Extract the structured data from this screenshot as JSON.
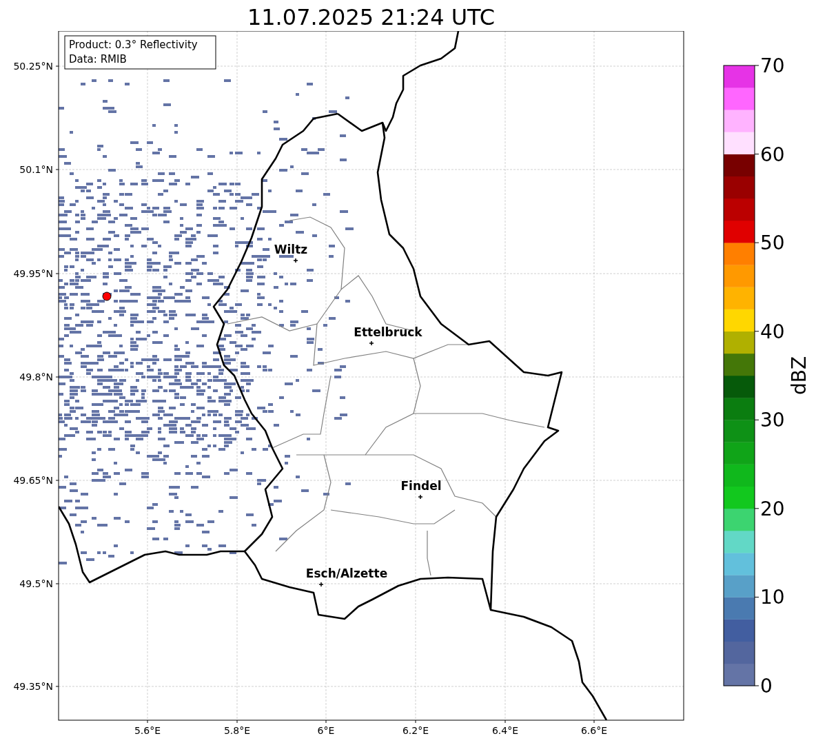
{
  "title": "11.07.2025 21:24 UTC",
  "info_box": {
    "lines": [
      "Product: 0.3° Reflectivity",
      "Data: RMIB"
    ]
  },
  "map": {
    "y_ticks": [
      "50.25°N",
      "50.1°N",
      "49.95°N",
      "49.8°N",
      "49.65°N",
      "49.5°N",
      "49.35°N"
    ],
    "x_ticks": [
      "5.6°E",
      "5.8°E",
      "6°E",
      "6.2°E",
      "6.4°E",
      "6.6°E"
    ],
    "cities": [
      {
        "name": "Wiltz"
      },
      {
        "name": "Ettelbruck"
      },
      {
        "name": "Findel"
      },
      {
        "name": "Esch/Alzette"
      }
    ]
  },
  "colorbar": {
    "label": "dBZ",
    "ticks": [
      "70",
      "60",
      "50",
      "40",
      "30",
      "20",
      "10",
      "0"
    ],
    "bands": [
      {
        "color": "#6474a6"
      },
      {
        "color": "#53669e"
      },
      {
        "color": "#425ea0"
      },
      {
        "color": "#4a7ab0"
      },
      {
        "color": "#58a0c8"
      },
      {
        "color": "#62c0dc"
      },
      {
        "color": "#62d8c6"
      },
      {
        "color": "#3cd470"
      },
      {
        "color": "#12c81e"
      },
      {
        "color": "#10b81c"
      },
      {
        "color": "#10a418"
      },
      {
        "color": "#0e9116"
      },
      {
        "color": "#0b7d10"
      },
      {
        "color": "#065a0a"
      },
      {
        "color": "#447708"
      },
      {
        "color": "#b0b000"
      },
      {
        "color": "#ffd700"
      },
      {
        "color": "#ffb300"
      },
      {
        "color": "#ff9900"
      },
      {
        "color": "#ff7f00"
      },
      {
        "color": "#e00000"
      },
      {
        "color": "#bb0000"
      },
      {
        "color": "#9a0000"
      },
      {
        "color": "#780000"
      },
      {
        "color": "#ffe0ff"
      },
      {
        "color": "#ffb3ff"
      },
      {
        "color": "#ff66ff"
      },
      {
        "color": "#e633e6"
      }
    ]
  }
}
